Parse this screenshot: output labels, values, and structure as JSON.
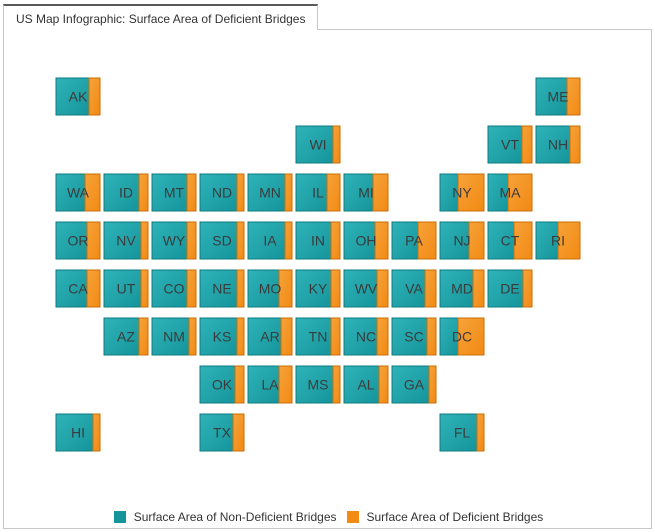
{
  "tab": {
    "title": "US Map Infographic: Surface Area of Deficient Bridges"
  },
  "colors": {
    "non_deficient": "#15959b",
    "deficient": "#f28a13"
  },
  "chart_data": {
    "type": "tile-map",
    "title": "US Map Infographic: Surface Area of Deficient Bridges",
    "series": [
      {
        "name": "Surface Area of Non-Deficient Bridges"
      },
      {
        "name": "Surface Area of Deficient Bridges"
      }
    ],
    "tiles": [
      {
        "state": "AK",
        "col": 0,
        "row": 0,
        "deficient_fraction": 0.25
      },
      {
        "state": "ME",
        "col": 10,
        "row": 0,
        "deficient_fraction": 0.3
      },
      {
        "state": "WI",
        "col": 5,
        "row": 1,
        "deficient_fraction": 0.15
      },
      {
        "state": "VT",
        "col": 9,
        "row": 1,
        "deficient_fraction": 0.22
      },
      {
        "state": "NH",
        "col": 10,
        "row": 1,
        "deficient_fraction": 0.22
      },
      {
        "state": "WA",
        "col": 0,
        "row": 2,
        "deficient_fraction": 0.35
      },
      {
        "state": "ID",
        "col": 1,
        "row": 2,
        "deficient_fraction": 0.2
      },
      {
        "state": "MT",
        "col": 2,
        "row": 2,
        "deficient_fraction": 0.2
      },
      {
        "state": "ND",
        "col": 3,
        "row": 2,
        "deficient_fraction": 0.15
      },
      {
        "state": "MN",
        "col": 4,
        "row": 2,
        "deficient_fraction": 0.15
      },
      {
        "state": "IL",
        "col": 5,
        "row": 2,
        "deficient_fraction": 0.3
      },
      {
        "state": "MI",
        "col": 6,
        "row": 2,
        "deficient_fraction": 0.35
      },
      {
        "state": "NY",
        "col": 8,
        "row": 2,
        "deficient_fraction": 0.6
      },
      {
        "state": "MA",
        "col": 9,
        "row": 2,
        "deficient_fraction": 0.55
      },
      {
        "state": "OR",
        "col": 0,
        "row": 3,
        "deficient_fraction": 0.3
      },
      {
        "state": "NV",
        "col": 1,
        "row": 3,
        "deficient_fraction": 0.15
      },
      {
        "state": "WY",
        "col": 2,
        "row": 3,
        "deficient_fraction": 0.2
      },
      {
        "state": "SD",
        "col": 3,
        "row": 3,
        "deficient_fraction": 0.15
      },
      {
        "state": "IA",
        "col": 4,
        "row": 3,
        "deficient_fraction": 0.15
      },
      {
        "state": "IN",
        "col": 5,
        "row": 3,
        "deficient_fraction": 0.2
      },
      {
        "state": "OH",
        "col": 6,
        "row": 3,
        "deficient_fraction": 0.3
      },
      {
        "state": "PA",
        "col": 7,
        "row": 3,
        "deficient_fraction": 0.4
      },
      {
        "state": "NJ",
        "col": 8,
        "row": 3,
        "deficient_fraction": 0.35
      },
      {
        "state": "CT",
        "col": 9,
        "row": 3,
        "deficient_fraction": 0.4
      },
      {
        "state": "RI",
        "col": 10,
        "row": 3,
        "deficient_fraction": 0.5
      },
      {
        "state": "CA",
        "col": 0,
        "row": 4,
        "deficient_fraction": 0.3
      },
      {
        "state": "UT",
        "col": 1,
        "row": 4,
        "deficient_fraction": 0.15
      },
      {
        "state": "CO",
        "col": 2,
        "row": 4,
        "deficient_fraction": 0.2
      },
      {
        "state": "NE",
        "col": 3,
        "row": 4,
        "deficient_fraction": 0.15
      },
      {
        "state": "MO",
        "col": 4,
        "row": 4,
        "deficient_fraction": 0.3
      },
      {
        "state": "KY",
        "col": 5,
        "row": 4,
        "deficient_fraction": 0.2
      },
      {
        "state": "WV",
        "col": 6,
        "row": 4,
        "deficient_fraction": 0.25
      },
      {
        "state": "VA",
        "col": 7,
        "row": 4,
        "deficient_fraction": 0.25
      },
      {
        "state": "MD",
        "col": 8,
        "row": 4,
        "deficient_fraction": 0.25
      },
      {
        "state": "DE",
        "col": 9,
        "row": 4,
        "deficient_fraction": 0.2
      },
      {
        "state": "AZ",
        "col": 1,
        "row": 5,
        "deficient_fraction": 0.2
      },
      {
        "state": "NM",
        "col": 2,
        "row": 5,
        "deficient_fraction": 0.15
      },
      {
        "state": "KS",
        "col": 3,
        "row": 5,
        "deficient_fraction": 0.15
      },
      {
        "state": "AR",
        "col": 4,
        "row": 5,
        "deficient_fraction": 0.25
      },
      {
        "state": "TN",
        "col": 5,
        "row": 5,
        "deficient_fraction": 0.2
      },
      {
        "state": "NC",
        "col": 6,
        "row": 5,
        "deficient_fraction": 0.25
      },
      {
        "state": "SC",
        "col": 7,
        "row": 5,
        "deficient_fraction": 0.2
      },
      {
        "state": "DC",
        "col": 8,
        "row": 5,
        "deficient_fraction": 0.6
      },
      {
        "state": "OK",
        "col": 3,
        "row": 6,
        "deficient_fraction": 0.2
      },
      {
        "state": "LA",
        "col": 4,
        "row": 6,
        "deficient_fraction": 0.3
      },
      {
        "state": "MS",
        "col": 5,
        "row": 6,
        "deficient_fraction": 0.15
      },
      {
        "state": "AL",
        "col": 6,
        "row": 6,
        "deficient_fraction": 0.2
      },
      {
        "state": "GA",
        "col": 7,
        "row": 6,
        "deficient_fraction": 0.15
      },
      {
        "state": "HI",
        "col": 0,
        "row": 7,
        "deficient_fraction": 0.15
      },
      {
        "state": "TX",
        "col": 3,
        "row": 7,
        "deficient_fraction": 0.25
      },
      {
        "state": "FL",
        "col": 8,
        "row": 7,
        "deficient_fraction": 0.15
      }
    ],
    "legend": "bottom-center"
  }
}
